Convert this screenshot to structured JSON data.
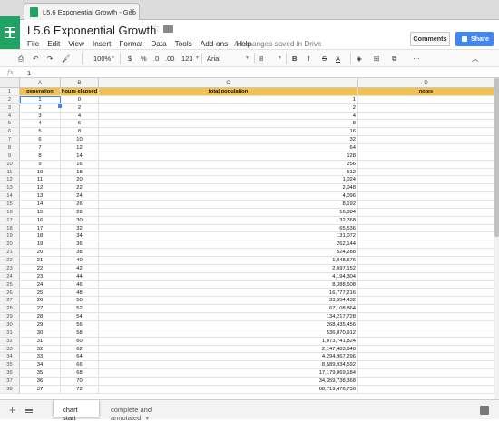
{
  "browser": {
    "tab_title": "L5.6 Exponential Growth - Goo",
    "close": "✕"
  },
  "app": {
    "title": "L5.6 Exponential Growth",
    "menu": [
      "File",
      "Edit",
      "View",
      "Insert",
      "Format",
      "Data",
      "Tools",
      "Add-ons",
      "Help"
    ],
    "save_status": "All changes saved in Drive",
    "comments_label": "Comments",
    "share_label": "Share",
    "brand_color": "#1fa463",
    "accent_color": "#4285f4"
  },
  "toolbar": {
    "zoom": "100%",
    "currency": "$",
    "percent": "%",
    "dec_decrease": ".0",
    "dec_increase": ".00",
    "more_formats": "123",
    "font": "Arial",
    "font_size": "8",
    "bold": "B",
    "italic": "I",
    "strike": "S",
    "text_color": "A"
  },
  "formula_bar": {
    "fx": "fx",
    "value": "1"
  },
  "columns": [
    "A",
    "B",
    "C",
    "D"
  ],
  "header_row": {
    "row_number": "1",
    "cells": [
      "generation",
      "hours elapsed",
      "total population",
      "notes"
    ],
    "fill_color": "#f2c14e"
  },
  "rows": [
    {
      "n": "2",
      "a": "1",
      "b": "0",
      "c": "1"
    },
    {
      "n": "3",
      "a": "2",
      "b": "2",
      "c": "2"
    },
    {
      "n": "4",
      "a": "3",
      "b": "4",
      "c": "4"
    },
    {
      "n": "5",
      "a": "4",
      "b": "6",
      "c": "8"
    },
    {
      "n": "6",
      "a": "5",
      "b": "8",
      "c": "16"
    },
    {
      "n": "7",
      "a": "6",
      "b": "10",
      "c": "32"
    },
    {
      "n": "8",
      "a": "7",
      "b": "12",
      "c": "64"
    },
    {
      "n": "9",
      "a": "8",
      "b": "14",
      "c": "128"
    },
    {
      "n": "10",
      "a": "9",
      "b": "16",
      "c": "256"
    },
    {
      "n": "11",
      "a": "10",
      "b": "18",
      "c": "512"
    },
    {
      "n": "12",
      "a": "11",
      "b": "20",
      "c": "1,024"
    },
    {
      "n": "13",
      "a": "12",
      "b": "22",
      "c": "2,048"
    },
    {
      "n": "14",
      "a": "13",
      "b": "24",
      "c": "4,096"
    },
    {
      "n": "15",
      "a": "14",
      "b": "26",
      "c": "8,192"
    },
    {
      "n": "16",
      "a": "15",
      "b": "28",
      "c": "16,384"
    },
    {
      "n": "17",
      "a": "16",
      "b": "30",
      "c": "32,768"
    },
    {
      "n": "18",
      "a": "17",
      "b": "32",
      "c": "65,536"
    },
    {
      "n": "19",
      "a": "18",
      "b": "34",
      "c": "131,072"
    },
    {
      "n": "20",
      "a": "19",
      "b": "36",
      "c": "262,144"
    },
    {
      "n": "21",
      "a": "20",
      "b": "38",
      "c": "524,288"
    },
    {
      "n": "22",
      "a": "21",
      "b": "40",
      "c": "1,048,576"
    },
    {
      "n": "23",
      "a": "22",
      "b": "42",
      "c": "2,097,152"
    },
    {
      "n": "24",
      "a": "23",
      "b": "44",
      "c": "4,194,304"
    },
    {
      "n": "25",
      "a": "24",
      "b": "46",
      "c": "8,388,608"
    },
    {
      "n": "26",
      "a": "25",
      "b": "48",
      "c": "16,777,216"
    },
    {
      "n": "27",
      "a": "26",
      "b": "50",
      "c": "33,554,432"
    },
    {
      "n": "28",
      "a": "27",
      "b": "52",
      "c": "67,108,864"
    },
    {
      "n": "29",
      "a": "28",
      "b": "54",
      "c": "134,217,728"
    },
    {
      "n": "30",
      "a": "29",
      "b": "56",
      "c": "268,435,456"
    },
    {
      "n": "31",
      "a": "30",
      "b": "58",
      "c": "536,870,912"
    },
    {
      "n": "32",
      "a": "31",
      "b": "60",
      "c": "1,073,741,824"
    },
    {
      "n": "33",
      "a": "32",
      "b": "62",
      "c": "2,147,483,648"
    },
    {
      "n": "34",
      "a": "33",
      "b": "64",
      "c": "4,294,967,296"
    },
    {
      "n": "35",
      "a": "34",
      "b": "66",
      "c": "8,589,934,592"
    },
    {
      "n": "36",
      "a": "35",
      "b": "68",
      "c": "17,179,869,184"
    },
    {
      "n": "37",
      "a": "36",
      "b": "70",
      "c": "34,359,738,368"
    },
    {
      "n": "38",
      "a": "37",
      "b": "72",
      "c": "68,719,476,736"
    }
  ],
  "sheets": {
    "tabs": [
      "chart start",
      "complete and annotated"
    ],
    "active": "chart start"
  }
}
